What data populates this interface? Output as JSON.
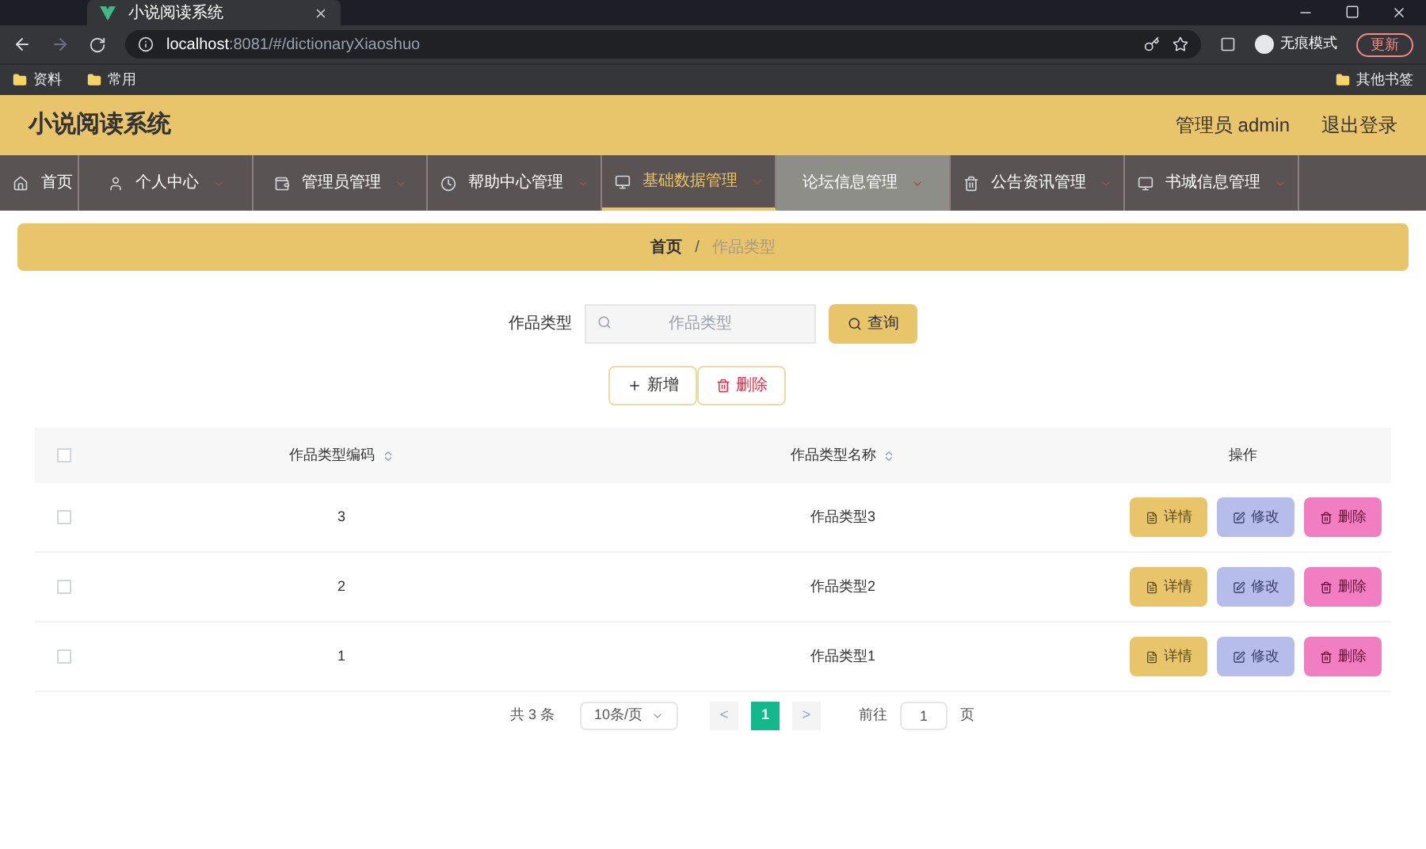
{
  "browser": {
    "tab_title": "小说阅读系统",
    "url_host": "localhost",
    "url_rest": ":8081/#/dictionaryXiaoshuo",
    "profile": "无痕模式",
    "update_button": "更新",
    "bookmarks": [
      "资料",
      "常用"
    ],
    "other_bookmarks": "其他书签"
  },
  "header": {
    "title": "小说阅读系统",
    "user": "管理员 admin",
    "logout": "退出登录"
  },
  "nav": [
    {
      "label": "首页",
      "selected": false,
      "hovered": false
    },
    {
      "label": "个人中心",
      "selected": false,
      "hovered": false
    },
    {
      "label": "管理员管理",
      "selected": false,
      "hovered": false
    },
    {
      "label": "帮助中心管理",
      "selected": false,
      "hovered": false
    },
    {
      "label": "基础数据管理",
      "selected": true,
      "hovered": false
    },
    {
      "label": "论坛信息管理",
      "selected": false,
      "hovered": true
    },
    {
      "label": "公告资讯管理",
      "selected": false,
      "hovered": false
    },
    {
      "label": "书城信息管理",
      "selected": false,
      "hovered": false
    }
  ],
  "breadcrumb": {
    "home": "首页",
    "separator": "/",
    "current": "作品类型"
  },
  "search": {
    "label": "作品类型",
    "placeholder": "作品类型",
    "button": "查询"
  },
  "actions": {
    "add": "新增",
    "delete": "删除"
  },
  "table": {
    "columns": [
      "作品类型编码",
      "作品类型名称",
      "操作"
    ],
    "all_checked": false,
    "rows": [
      {
        "code": "3",
        "name": "作品类型3",
        "checked": false,
        "buttons": [
          "详情",
          "修改",
          "删除"
        ]
      },
      {
        "code": "2",
        "name": "作品类型2",
        "checked": false,
        "buttons": [
          "详情",
          "修改",
          "删除"
        ]
      },
      {
        "code": "1",
        "name": "作品类型1",
        "checked": false,
        "buttons": [
          "详情",
          "修改",
          "删除"
        ]
      }
    ]
  },
  "pagination": {
    "total": "共 3 条",
    "page_size": "10条/页",
    "prev": "<",
    "pages": [
      {
        "label": "1",
        "selected": true
      }
    ],
    "next": ">",
    "goto": "前往",
    "goto_value": "1",
    "page_unit": "页"
  }
}
